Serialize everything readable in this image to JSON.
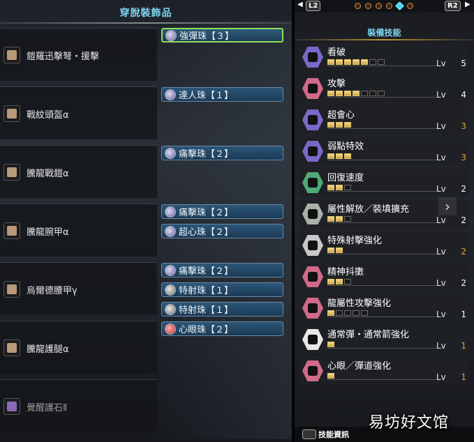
{
  "left_panel": {
    "title": "穿脫裝飾品",
    "equipment": [
      {
        "name": "鎧羅迅擊弩・援擊",
        "icon": "bowgun-icon"
      },
      {
        "name": "戰紋頭盔α",
        "icon": "helmet-icon"
      },
      {
        "name": "騰龍戰鎧α",
        "icon": "chest-armor-icon"
      },
      {
        "name": "騰龍腕甲α",
        "icon": "arm-armor-icon"
      },
      {
        "name": "烏爾德腰甲γ",
        "icon": "waist-armor-icon"
      },
      {
        "name": "騰龍護腿α",
        "icon": "leg-armor-icon"
      },
      {
        "name": "覺醒護石Ⅱ",
        "icon": "charm-icon"
      }
    ],
    "decorations": [
      {
        "label": "強彈珠【３】",
        "gem": "purple",
        "selected": true
      },
      {
        "label": "達人珠【１】",
        "gem": "purple",
        "selected": false
      },
      {
        "label": "痛擊珠【２】",
        "gem": "purple",
        "selected": false
      },
      {
        "label": "痛擊珠【２】",
        "gem": "purple",
        "selected": false
      },
      {
        "label": "超心珠【２】",
        "gem": "purple",
        "selected": false
      },
      {
        "label": "痛擊珠【２】",
        "gem": "purple",
        "selected": false
      },
      {
        "label": "特射珠【１】",
        "gem": "gray",
        "selected": false
      },
      {
        "label": "特射珠【１】",
        "gem": "gray",
        "selected": false
      },
      {
        "label": "心眼珠【２】",
        "gem": "red",
        "selected": false
      }
    ]
  },
  "right_panel": {
    "nav": {
      "left_button": "L2",
      "right_button": "R2",
      "page_count": 5,
      "active_page": 4
    },
    "title": "裝備技能",
    "skills": [
      {
        "name": "看破",
        "level": "5",
        "max": 7,
        "lv_label": "Lv",
        "color": "#7b68c8",
        "level_color": "#ffffff"
      },
      {
        "name": "攻擊",
        "level": "4",
        "max": 7,
        "lv_label": "Lv",
        "color": "#d06a88",
        "level_color": "#ffffff"
      },
      {
        "name": "超會心",
        "level": "3",
        "max": 3,
        "lv_label": "Lv",
        "color": "#7b68c8",
        "level_color": "#f0a030"
      },
      {
        "name": "弱點特效",
        "level": "3",
        "max": 3,
        "lv_label": "Lv",
        "color": "#7b68c8",
        "level_color": "#f0a030"
      },
      {
        "name": "回復速度",
        "level": "2",
        "max": 3,
        "lv_label": "Lv",
        "color": "#4fa878",
        "level_color": "#ffffff"
      },
      {
        "name": "屬性解放／裝填擴充",
        "level": "2",
        "max": 3,
        "lv_label": "Lv",
        "color": "#a8b0a8",
        "level_color": "#ffffff"
      },
      {
        "name": "特殊射擊強化",
        "level": "2",
        "max": 2,
        "lv_label": "Lv",
        "color": "#c8c8c8",
        "level_color": "#f0a030"
      },
      {
        "name": "精神抖擻",
        "level": "2",
        "max": 3,
        "lv_label": "Lv",
        "color": "#d06a88",
        "level_color": "#ffffff"
      },
      {
        "name": "龍屬性攻擊強化",
        "level": "1",
        "max": 5,
        "lv_label": "Lv",
        "color": "#d06a88",
        "level_color": "#ffffff"
      },
      {
        "name": "通常彈・通常箭強化",
        "level": "1",
        "max": 1,
        "lv_label": "Lv",
        "color": "#e8e8e8",
        "level_color": "#f0a030"
      },
      {
        "name": "心眼／彈道強化",
        "level": "1",
        "max": 1,
        "lv_label": "Lv",
        "color": "#d06a88",
        "level_color": "#f0a030"
      }
    ],
    "footer_label": "技能資訊"
  },
  "watermark": "易坊好文馆"
}
